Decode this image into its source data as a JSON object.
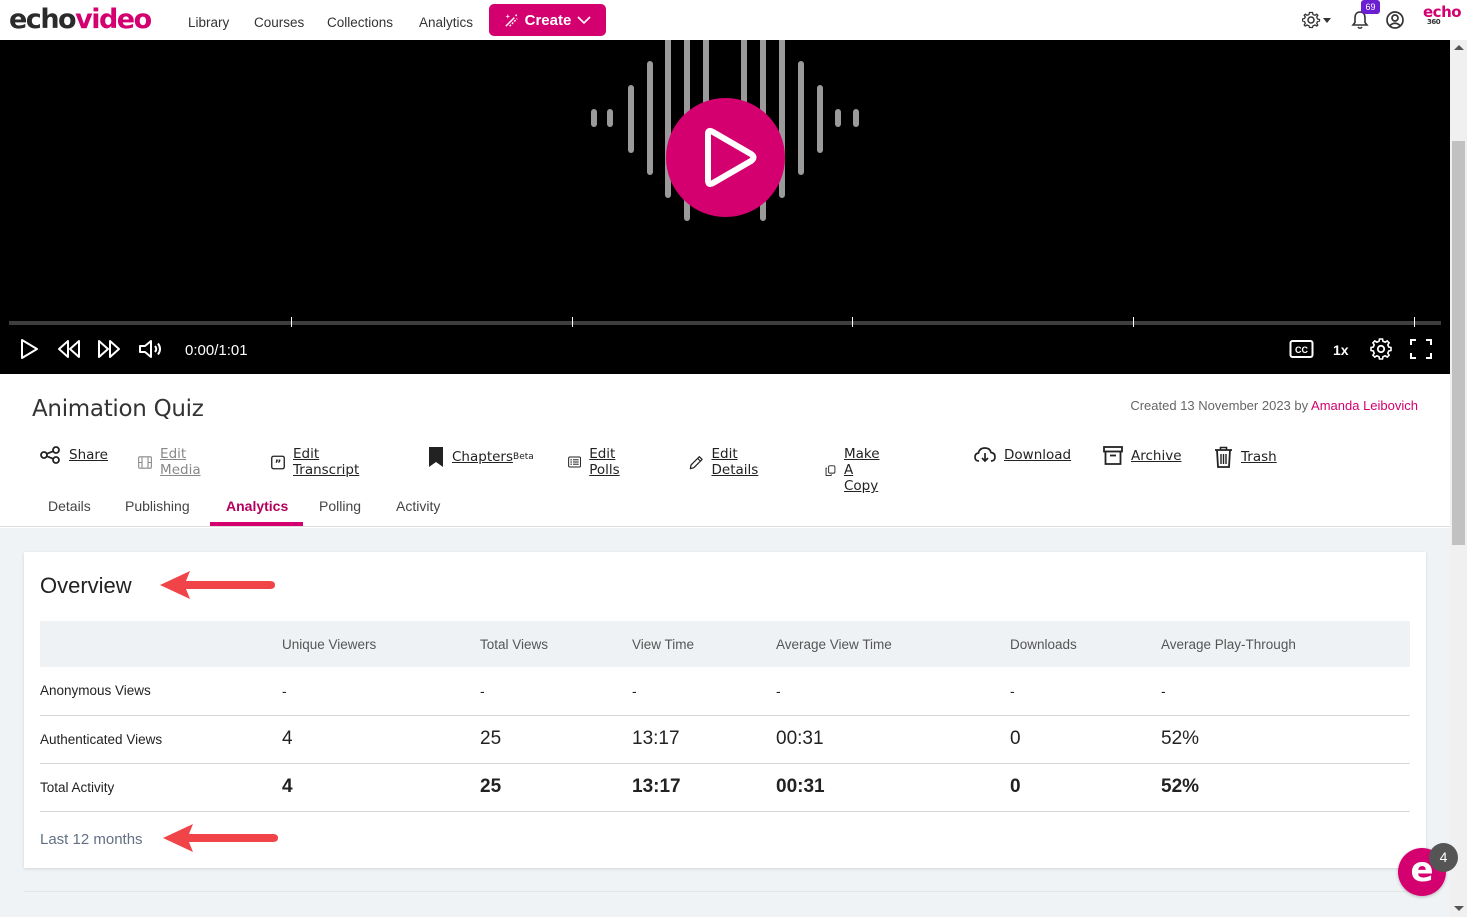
{
  "app": {
    "logo_left": "echo",
    "logo_right": "video",
    "brand_color": "#d4006f"
  },
  "nav": {
    "links": [
      "Library",
      "Courses",
      "Collections",
      "Analytics"
    ],
    "create_label": "Create",
    "notification_count": "69",
    "brand_mark": "echo",
    "brand_mark_sub": "360"
  },
  "player": {
    "time": "0:00/1:01",
    "speed": "1x",
    "progress_fraction": 0,
    "chapter_marker_fractions": [
      0.197,
      0.393,
      0.589,
      0.785,
      0.981
    ],
    "controls": [
      "play-icon",
      "rewind-icon",
      "fast-forward-icon",
      "volume-icon",
      "captions-icon",
      "speed",
      "settings-icon",
      "fullscreen-icon"
    ]
  },
  "media": {
    "title": "Animation Quiz",
    "created_prefix": "Created 13 November 2023 by",
    "author": "Amanda Leibovich",
    "actions": [
      {
        "label": "Share",
        "icon": "share-icon",
        "enabled": true
      },
      {
        "label": "Edit Media",
        "icon": "film-icon",
        "enabled": false
      },
      {
        "label": "Edit Transcript",
        "icon": "quote-icon",
        "enabled": true
      },
      {
        "label": "Chapters",
        "sup": "Beta",
        "icon": "bookmark-icon",
        "enabled": true
      },
      {
        "label": "Edit Polls",
        "icon": "list-icon",
        "enabled": true
      },
      {
        "label": "Edit Details",
        "icon": "pencil-icon",
        "enabled": true
      },
      {
        "label": "Make A Copy",
        "icon": "copy-icon",
        "enabled": true
      },
      {
        "label": "Download",
        "icon": "cloud-download-icon",
        "enabled": true
      },
      {
        "label": "Archive",
        "icon": "archive-icon",
        "enabled": true
      },
      {
        "label": "Trash",
        "icon": "trash-icon",
        "enabled": true
      }
    ]
  },
  "tabs": [
    {
      "label": "Details",
      "active": false
    },
    {
      "label": "Publishing",
      "active": false
    },
    {
      "label": "Analytics",
      "active": true
    },
    {
      "label": "Polling",
      "active": false
    },
    {
      "label": "Activity",
      "active": false
    }
  ],
  "overview": {
    "title": "Overview",
    "columns": [
      "",
      "Unique Viewers",
      "Total Views",
      "View Time",
      "Average View Time",
      "Downloads",
      "Average Play-Through"
    ],
    "rows": [
      {
        "label": "Anonymous Views",
        "values": [
          "-",
          "-",
          "-",
          "-",
          "-",
          "-"
        ]
      },
      {
        "label": "Authenticated Views",
        "values": [
          "4",
          "25",
          "13:17",
          "00:31",
          "0",
          "52%"
        ]
      },
      {
        "label": "Total Activity",
        "values": [
          "4",
          "25",
          "13:17",
          "00:31",
          "0",
          "52%"
        ]
      }
    ],
    "period": "Last 12 months"
  },
  "help": {
    "glyph": "e",
    "count": "4"
  },
  "annotations": {
    "arrow_color": "#f04448"
  }
}
